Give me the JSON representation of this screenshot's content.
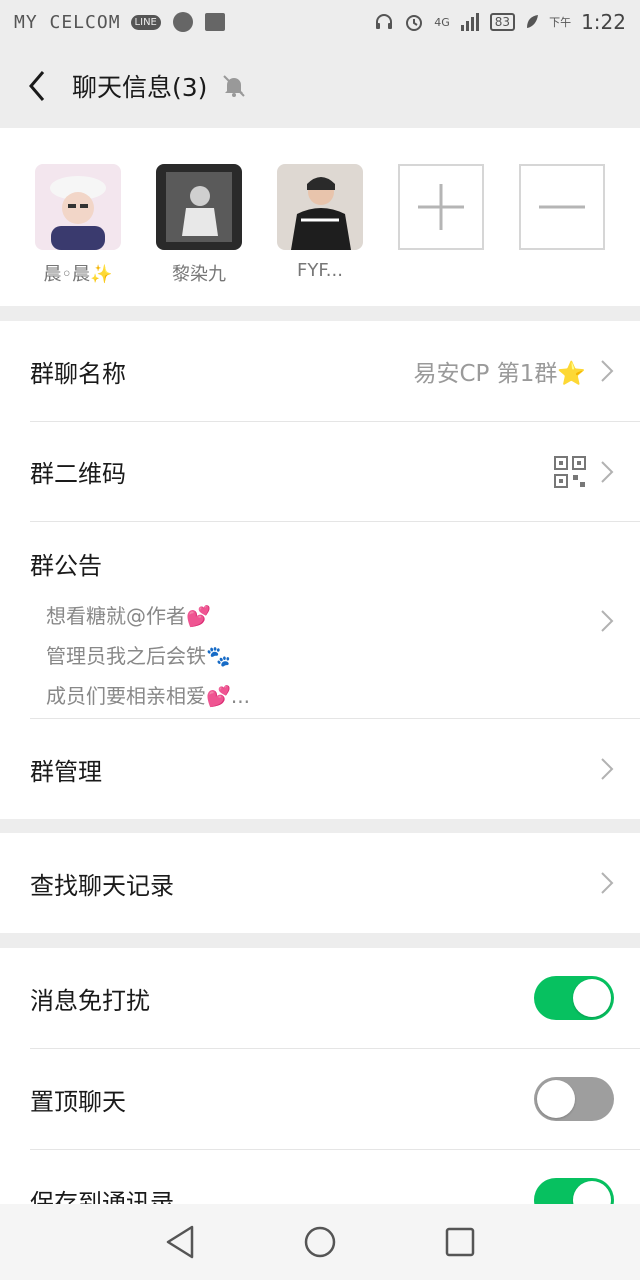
{
  "status_bar": {
    "carrier": "MY CELCOM",
    "line_badge": "LINE",
    "network": "4G",
    "battery": "83",
    "period": "下午",
    "time": "1:22"
  },
  "header": {
    "title": "聊天信息(3)"
  },
  "members": [
    {
      "name": "晨◦晨✨"
    },
    {
      "name": "黎染九"
    },
    {
      "name": "FYF..."
    }
  ],
  "settings": {
    "group_name_label": "群聊名称",
    "group_name_value": "易安CP 第1群⭐",
    "qr_label": "群二维码",
    "notice_label": "群公告",
    "notice_lines": [
      "想看糖就@作者💕",
      "管理员我之后会铁🐾",
      "成员们要相亲相爱💕..."
    ],
    "manage_label": "群管理",
    "search_label": "查找聊天记录",
    "mute_label": "消息免打扰",
    "mute_on": true,
    "pin_label": "置顶聊天",
    "pin_on": false,
    "save_label": "保存到通讯录",
    "save_on": true
  },
  "colors": {
    "toggle_on": "#07c160",
    "toggle_off": "#9e9e9e",
    "background": "#ededed"
  }
}
